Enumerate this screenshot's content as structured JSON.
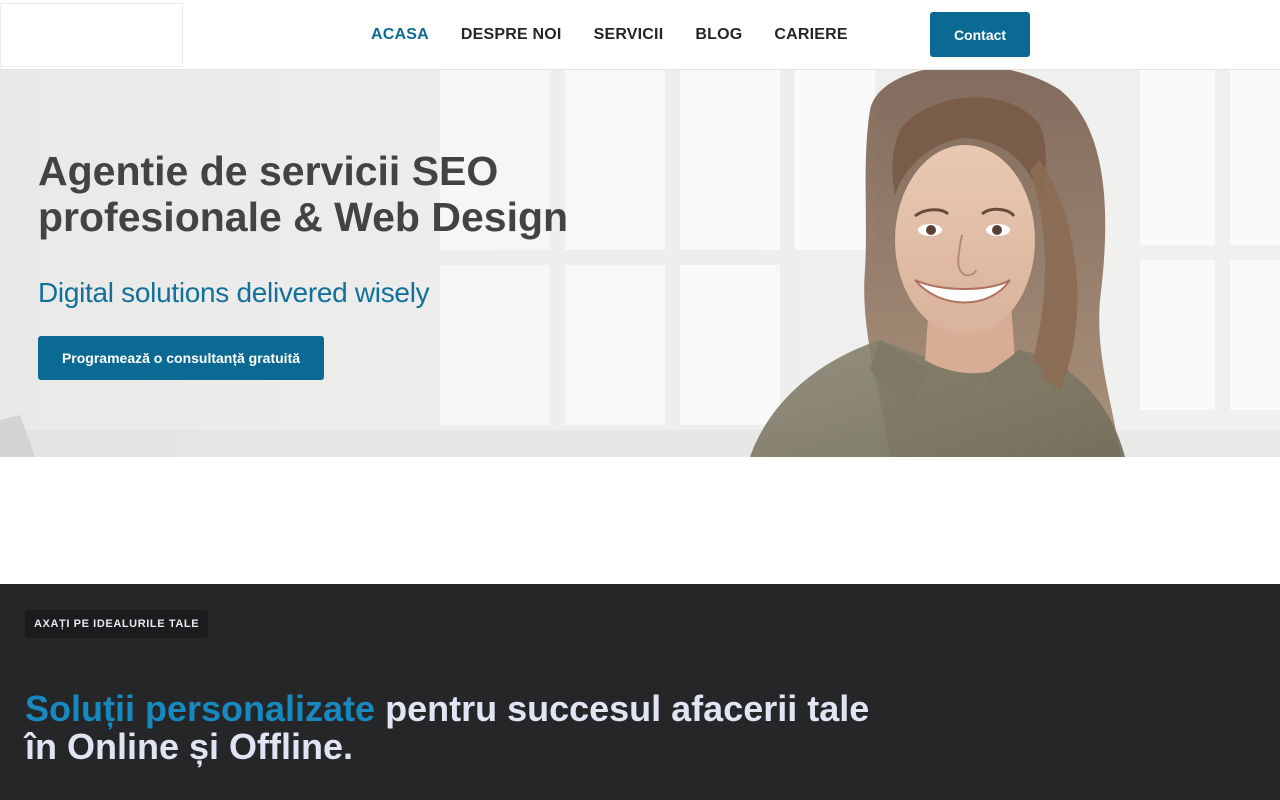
{
  "header": {
    "nav": [
      {
        "label": "ACASA",
        "active": true
      },
      {
        "label": "DESPRE NOI",
        "active": false
      },
      {
        "label": "SERVICII",
        "active": false
      },
      {
        "label": "BLOG",
        "active": false
      },
      {
        "label": "CARIERE",
        "active": false
      }
    ],
    "contact_label": "Contact"
  },
  "hero": {
    "title_line1": "Agentie de servicii SEO",
    "title_line2": "profesionale & Web Design",
    "subtitle": "Digital solutions delivered wisely",
    "cta_label": "Programează o consultanță gratuită"
  },
  "values_section": {
    "badge": "AXAȚI PE IDEALURILE TALE",
    "heading_accent": "Soluții personalizate",
    "heading_rest": " pentru succesul afacerii tale",
    "heading_line2": "în Online și Offline."
  },
  "colors": {
    "brand": "#0b6a93",
    "nav_active": "#0d6b93",
    "accent_blue": "#1789bf",
    "dark_bg": "#252628",
    "heading_gray": "#434343"
  }
}
